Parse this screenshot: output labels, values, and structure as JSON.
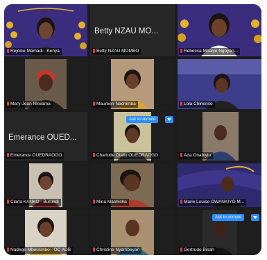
{
  "participants": [
    {
      "name": "Rejoice Mamadi - Kenya"
    },
    {
      "name": "Betty NZAU MOMBO",
      "display": "Betty NZAU MO..."
    },
    {
      "name": "Rebecca Mbaiye Ngoyan..."
    },
    {
      "name": "Mary-Jean Nkwama"
    },
    {
      "name": "Maureen Nachimba"
    },
    {
      "name": "Lola Chinonso"
    },
    {
      "name": "Emerance OUEDRAOGO",
      "display": "Emerance OUED..."
    },
    {
      "name": "Charlotte Diallo OUEDRAOGO"
    },
    {
      "name": "Ada Onabiyiu"
    },
    {
      "name": "Clarla KANKO - Burundi"
    },
    {
      "name": "Mina Mashisha"
    },
    {
      "name": "Marie Louise OWANKIYO M..."
    },
    {
      "name": "Nadege Mbousmbo - OC ADB"
    },
    {
      "name": "Christine Nyambeyan"
    },
    {
      "name": "Gertrude Bisah"
    }
  ],
  "ask_to_unmute": {
    "label": "Ask to unmute"
  },
  "colors": {
    "muted_mic": "#e23b3b",
    "accent": "#2d8cff",
    "grid_bg": "#1c1c1c"
  }
}
